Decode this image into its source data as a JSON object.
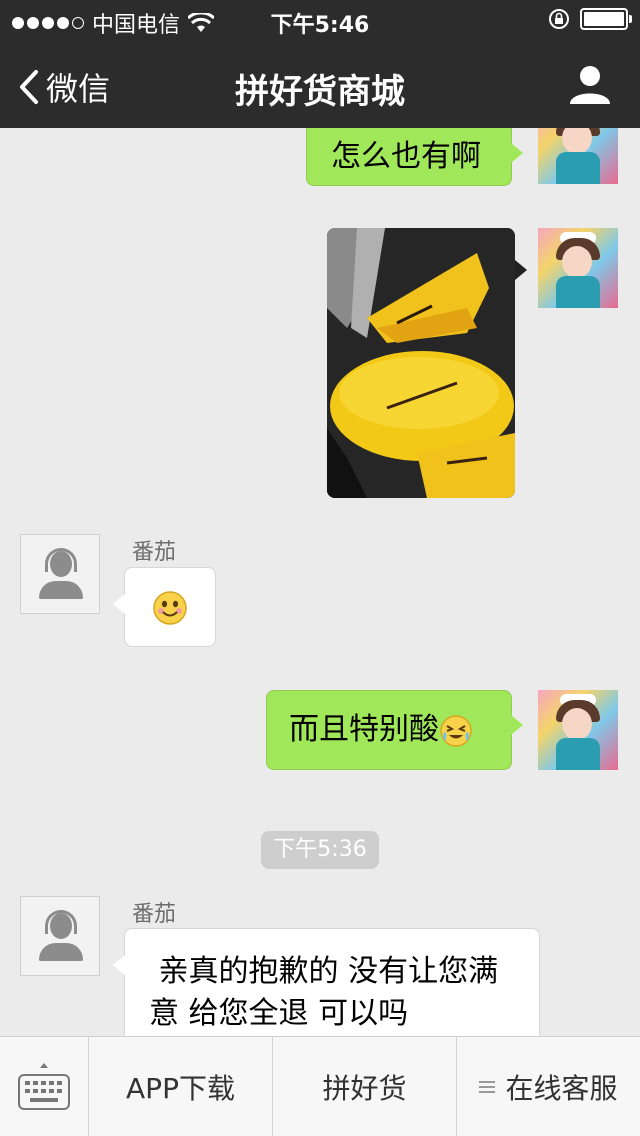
{
  "status": {
    "carrier": "中国电信",
    "time": "下午5:46"
  },
  "nav": {
    "back_label": "微信",
    "title": "拼好货商城"
  },
  "chat": {
    "messages": [
      {
        "type": "text",
        "direction": "outgoing",
        "text": "怎么也有啊"
      },
      {
        "type": "image",
        "direction": "outgoing",
        "description": "photo of cut yellow fruit on dark board"
      },
      {
        "type": "emoji",
        "direction": "incoming",
        "sender": "番茄",
        "emoji": "smile"
      },
      {
        "type": "text",
        "direction": "outgoing",
        "text": "而且特别酸",
        "emoji": "cry-laugh"
      },
      {
        "type": "text",
        "direction": "incoming",
        "sender": "番茄",
        "line1": " 亲真的抱歉的 没有让您满",
        "line2": "意 给您全退 可以吗"
      }
    ],
    "timestamp": "下午5:36"
  },
  "bottom": {
    "items": [
      {
        "label": "APP下载"
      },
      {
        "label": "拼好货"
      },
      {
        "label": "在线客服",
        "icon": "menu-icon"
      }
    ]
  },
  "colors": {
    "bar_bg": "#2c2c2c",
    "out_bubble": "#a0e75a",
    "in_bubble": "#ffffff",
    "chat_bg": "#ebebeb"
  }
}
